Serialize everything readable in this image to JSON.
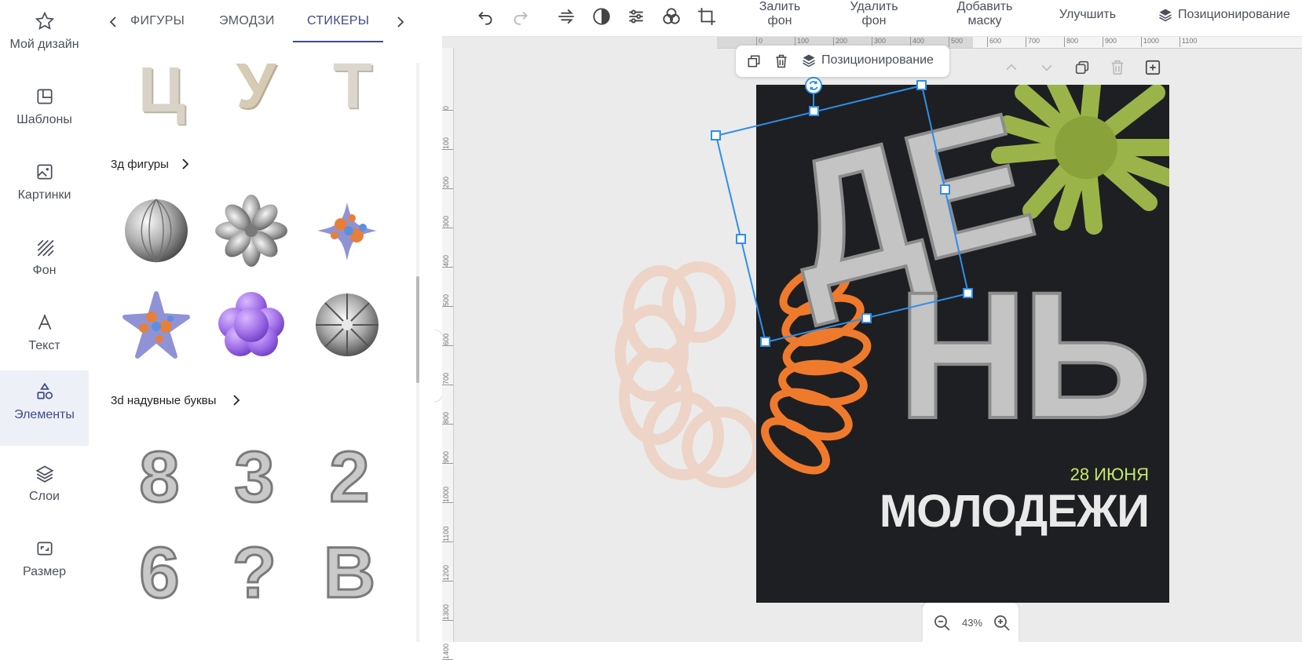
{
  "nav": {
    "items": [
      {
        "label": "Мой дизайн",
        "icon": "star-icon"
      },
      {
        "label": "Шаблоны",
        "icon": "template-icon"
      },
      {
        "label": "Картинки",
        "icon": "image-icon"
      },
      {
        "label": "Фон",
        "icon": "background-icon"
      },
      {
        "label": "Текст",
        "icon": "text-icon"
      },
      {
        "label": "Элементы",
        "icon": "shapes-icon",
        "active": true
      },
      {
        "label": "Слои",
        "icon": "layers-icon"
      },
      {
        "label": "Размер",
        "icon": "resize-icon"
      }
    ]
  },
  "panel": {
    "tabs": [
      "ФИГУРЫ",
      "ЭМОДЗИ",
      "СТИКЕРЫ"
    ],
    "active_tab": "СТИКЕРЫ",
    "top_letters": [
      "Ц",
      "У",
      "Т"
    ],
    "section1": {
      "title": "3д фигуры"
    },
    "section2": {
      "title": "3d надувные буквы"
    },
    "balloon_letters": [
      "8",
      "3",
      "2",
      "6",
      "?",
      "B"
    ]
  },
  "toolbar": {
    "fill_bg": "Залить\nфон",
    "remove_bg": "Удалить\nфон",
    "add_mask": "Добавить\nмаску",
    "enhance": "Улучшить",
    "positioning": "Позиционирование"
  },
  "context_bar": {
    "positioning": "Позиционирование"
  },
  "ruler": {
    "h_ticks": [
      "0",
      "100",
      "200",
      "300",
      "400",
      "500",
      "600",
      "700",
      "800",
      "900",
      "1000",
      "1100"
    ],
    "v_ticks": [
      "0",
      "100",
      "200",
      "300",
      "400",
      "500",
      "600",
      "700",
      "800",
      "900",
      "1000",
      "1100",
      "1200",
      "1300",
      "1400"
    ]
  },
  "poster": {
    "word1": "ДЕ",
    "word2": "НЬ",
    "date": "28 ИЮНЯ",
    "subtitle": "МОЛОДЕЖИ"
  },
  "zoom": {
    "value": "43%"
  },
  "colors": {
    "accent": "#3d4b8a",
    "selection": "#2f8ee8",
    "poster_bg": "#1e1f22",
    "lime": "#c6e86a",
    "orange": "#f07a2c",
    "green_sticker": "#8fa83a"
  }
}
